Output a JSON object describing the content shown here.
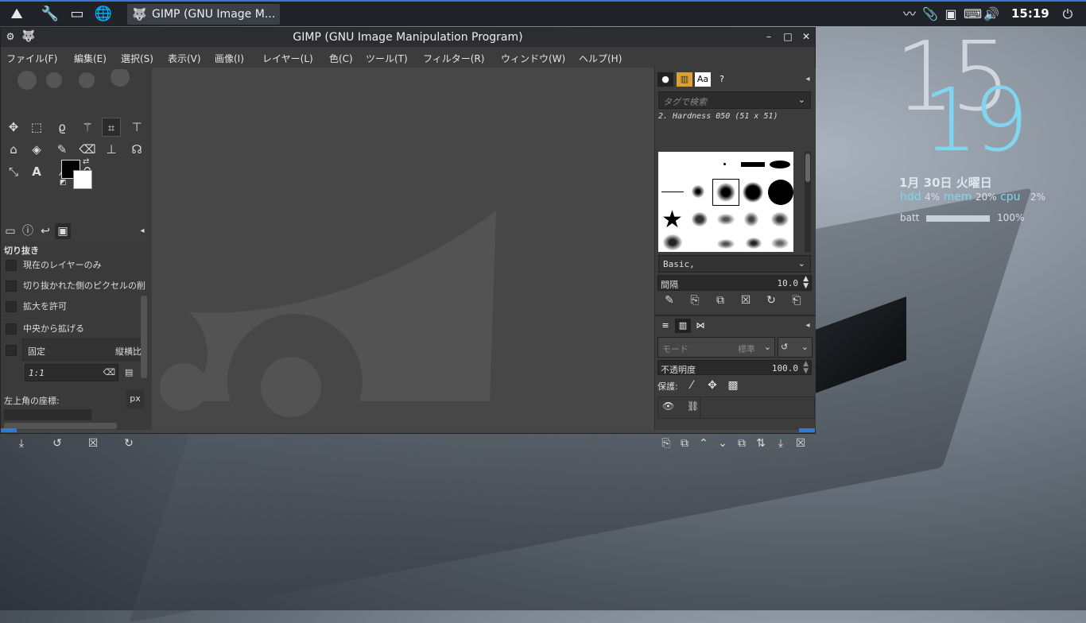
{
  "panel": {
    "task_title": "GIMP (GNU Image M...",
    "time": "15:19",
    "accent": "#2f7bd6"
  },
  "window": {
    "title": "GIMP (GNU Image Manipulation Program)",
    "menus": [
      "ファイル(F)",
      "編集(E)",
      "選択(S)",
      "表示(V)",
      "画像(I)",
      "レイヤー(L)",
      "色(C)",
      "ツール(T)",
      "フィルター(R)",
      "ウィンドウ(W)",
      "ヘルプ(H)"
    ]
  },
  "tool_options": {
    "heading": "切り抜き",
    "options": [
      "現在のレイヤーのみ",
      "切り抜かれた側のピクセルの削",
      "拡大を許可",
      "中央から拡げる"
    ],
    "fixed_label": "固定",
    "fixed_select": "縦横比",
    "ratio_value": "1:1",
    "position_label": "左上角の座標:",
    "unit": "px"
  },
  "brushes": {
    "search_placeholder": "タグで検索",
    "current_brush": "2. Hardness 050 (51 x 51)",
    "preset": "Basic,",
    "spacing_label": "間隔",
    "spacing_value": "10.0"
  },
  "layers": {
    "mode_label": "モード",
    "mode_value": "標準",
    "opacity_label": "不透明度",
    "opacity_value": "100.0",
    "lock_label": "保護:"
  },
  "conky": {
    "hour": "15",
    "minute": "19",
    "date": "1月 30日 火曜日",
    "hdd_label": "hdd",
    "hdd_value": "4%",
    "mem_label": "mem",
    "mem_value": "20%",
    "cpu_label": "cpu",
    "cpu_value": "2%",
    "batt_label": "batt",
    "batt_value": "100%",
    "batt_level": 1.0,
    "accent": "#7fd6ee"
  }
}
